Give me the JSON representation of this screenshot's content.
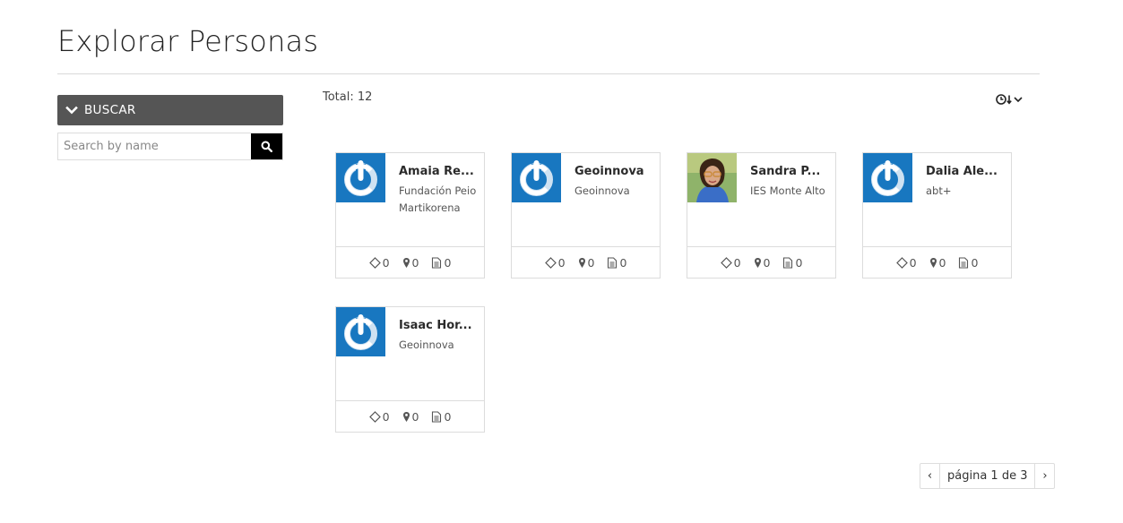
{
  "page": {
    "title": "Explorar Personas"
  },
  "sidebar": {
    "search_header": "BUSCAR",
    "search_placeholder": "Search by name"
  },
  "results": {
    "total_label": "Total: 12"
  },
  "cards": [
    {
      "name": "Amaia Re...",
      "org": "Fundación Peio Martikorena",
      "avatar": "default-power-avatar",
      "stats": {
        "projects": "0",
        "locations": "0",
        "documents": "0"
      }
    },
    {
      "name": "Geoinnova",
      "org": "Geoinnova",
      "avatar": "default-power-avatar",
      "stats": {
        "projects": "0",
        "locations": "0",
        "documents": "0"
      }
    },
    {
      "name": "Sandra P...",
      "org": "IES Monte Alto",
      "avatar": "profile-photo",
      "stats": {
        "projects": "0",
        "locations": "0",
        "documents": "0"
      }
    },
    {
      "name": "Dalia Ale...",
      "org": "abt+",
      "avatar": "default-power-avatar",
      "stats": {
        "projects": "0",
        "locations": "0",
        "documents": "0"
      }
    },
    {
      "name": "Isaac Hor...",
      "org": "Geoinnova",
      "avatar": "default-power-avatar",
      "stats": {
        "projects": "0",
        "locations": "0",
        "documents": "0"
      }
    }
  ],
  "pagination": {
    "label": "página 1 de 3",
    "prev": "‹",
    "next": "›"
  },
  "colors": {
    "accent_blue": "#1877c0",
    "header_gray": "#555555",
    "search_button": "#000000"
  },
  "icons": [
    "chevron-down-icon",
    "search-icon",
    "clock-sort-icon",
    "diamond-icon",
    "map-pin-icon",
    "document-icon"
  ]
}
